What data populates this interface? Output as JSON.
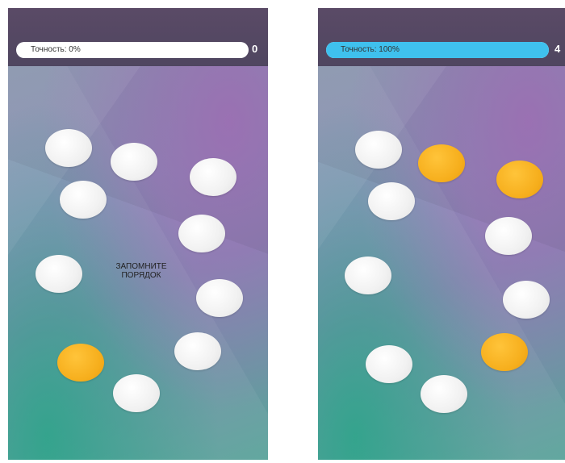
{
  "screens": [
    {
      "accuracy_label": "Точность: 0%",
      "accuracy_fraction": 0,
      "score": "0",
      "hint_line1": "ЗАПОМНИТЕ",
      "hint_line2": "ПОРЯДОК",
      "highlighted_circles": [
        9
      ],
      "circle_count": 11
    },
    {
      "accuracy_label": "Точность: 100%",
      "accuracy_fraction": 1,
      "score": "4",
      "highlighted_circles": [
        1,
        2,
        9
      ],
      "circle_count": 11
    }
  ],
  "colors": {
    "accuracy_fill": "#3fc1ee",
    "highlight": "#f6ae1c",
    "circle": "#f1f1f1",
    "topbar": "#554860"
  }
}
